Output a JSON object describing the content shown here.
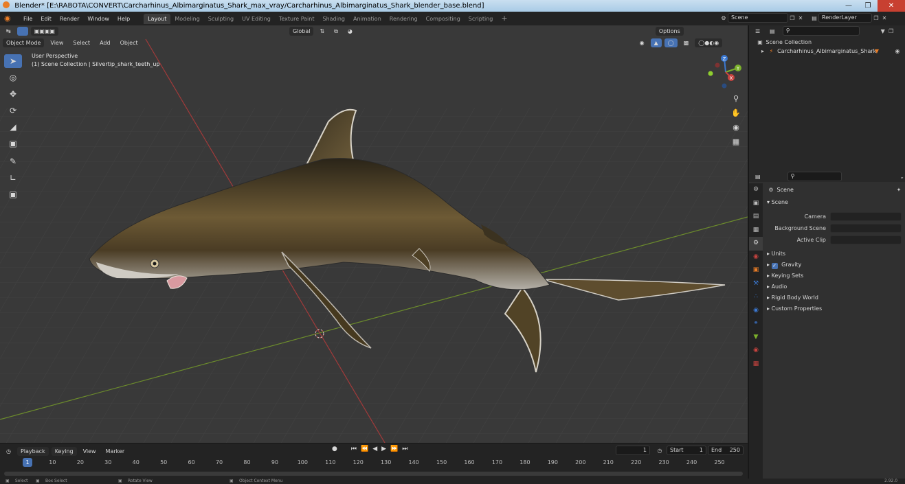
{
  "window": {
    "title": "Blender* [E:\\RABOTA\\CONVERT\\Carcharhinus_Albimarginatus_Shark_max_vray/Carcharhinus_Albimarginatus_Shark_blender_base.blend]"
  },
  "menu": {
    "items": [
      "File",
      "Edit",
      "Render",
      "Window",
      "Help"
    ]
  },
  "workspaces": {
    "tabs": [
      "Layout",
      "Modeling",
      "Sculpting",
      "UV Editing",
      "Texture Paint",
      "Shading",
      "Animation",
      "Rendering",
      "Compositing",
      "Scripting"
    ],
    "active": "Layout",
    "add": "+"
  },
  "scene_selector": {
    "scene": "Scene",
    "view_layer": "RenderLayer"
  },
  "viewport": {
    "transform_orientation": "Global",
    "options_label": "Options",
    "mode": "Object Mode",
    "header_menus": [
      "View",
      "Select",
      "Add",
      "Object"
    ],
    "overlay_line1": "User Perspective",
    "overlay_line2": "(1) Scene Collection | Silvertip_shark_teeth_up",
    "gizmo_axes": [
      "Z",
      "Y",
      "X"
    ],
    "tools": [
      "select-box",
      "cursor",
      "move",
      "rotate",
      "scale",
      "transform",
      "annotate",
      "measure",
      "add-cube"
    ]
  },
  "timeline": {
    "menus": [
      "Playback",
      "Keying",
      "View",
      "Marker"
    ],
    "current_frame": "1",
    "start_label": "Start",
    "start": "1",
    "end_label": "End",
    "end": "250",
    "ruler_labels": [
      "1",
      "10",
      "20",
      "30",
      "40",
      "50",
      "60",
      "70",
      "80",
      "90",
      "100",
      "110",
      "120",
      "130",
      "140",
      "150",
      "160",
      "170",
      "180",
      "190",
      "200",
      "210",
      "220",
      "230",
      "240",
      "250"
    ]
  },
  "statusbar": {
    "select": "Select",
    "box_select": "Box Select",
    "rotate_view": "Rotate View",
    "context_menu": "Object Context Menu",
    "version": "2.92.0"
  },
  "outliner": {
    "root": "Scene Collection",
    "items": [
      {
        "label": "Carcharhinus_Albimarginatus_Shark"
      }
    ]
  },
  "properties": {
    "context_title": "Scene",
    "panel_scene": "Scene",
    "fields": [
      {
        "label": "Camera"
      },
      {
        "label": "Background Scene"
      },
      {
        "label": "Active Clip"
      }
    ],
    "panels": [
      "Units",
      "Gravity",
      "Keying Sets",
      "Audio",
      "Rigid Body World",
      "Custom Properties"
    ],
    "gravity_enabled": true
  },
  "colors": {
    "accent": "#4772b3",
    "x_axis": "#c8433f",
    "y_axis": "#7bb12b",
    "z_axis": "#3b78d1",
    "viewport_bg": "#393939"
  }
}
